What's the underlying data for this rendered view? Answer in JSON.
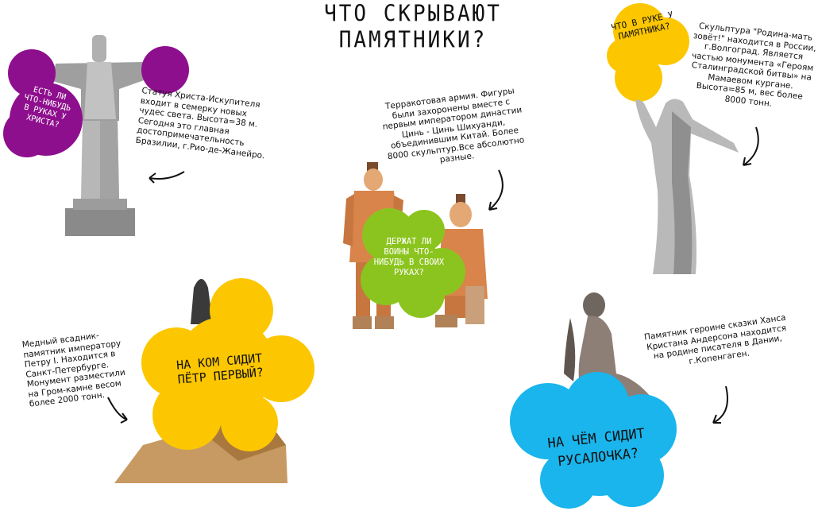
{
  "title": "ЧТО СКРЫВАЮТ ПАМЯТНИКИ?",
  "christ": {
    "question": "ЕСТЬ ЛИ ЧТО-НИБУДЬ В РУКАХ У ХРИСТА?",
    "fact": "Статуя Христа-Искупителя входит в семерку новых чудес света. Высота=38 м. Сегодня это главная достопримечательность Бразилии, г.Рио-де-Жанейро.",
    "color": "#8e0f8e"
  },
  "terracotta": {
    "question": "ДЕРЖАТ ЛИ ВОИНЫ ЧТО-НИБУДЬ В СВОИХ РУКАХ?",
    "fact": "Терракотовая армия. Фигуры были захоронены вместе с первым императором династии Цинь - Цинь Шихуанди, объединившим Китай. Более 8000 скульптур.Все абсолютно разные.",
    "color": "#8cc41f"
  },
  "motherland": {
    "question": "ЧТО В РУКЕ У ПАМЯТНИКА?",
    "fact": "Скульптура \"Родина-мать зовёт!\" находится в России, г.Волгоград. Является частью монумента «Героям Сталинградской битвы» на Мамаевом кургане. Высота=85 м, вес более 8000 тонн.",
    "color": "#fcc700"
  },
  "peter": {
    "question": "НА КОМ СИДИТ ПЁТР ПЕРВЫЙ?",
    "fact": "Медный всадник-памятник императору Петру I. Находится в Санкт-Петербурге. Монумент разместили на Гром-камне весом более 2000 тонн.",
    "color": "#fcc700"
  },
  "mermaid": {
    "question": "НА ЧЁМ СИДИТ РУСАЛОЧКА?",
    "fact": "Памятник героине сказки Ханса Кристана Андерсона находится на родине писателя в Дании, г.Копенгаген.",
    "color": "#19b5ec"
  }
}
